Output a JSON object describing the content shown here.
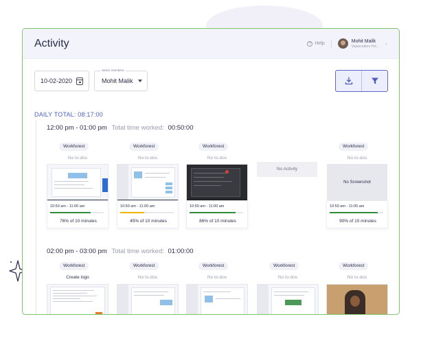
{
  "header": {
    "title": "Activity",
    "help_label": "Help",
    "user_name": "Mohit Malik",
    "user_org": "Valuecoders Pvt..."
  },
  "controls": {
    "date_value": "10-02-2020",
    "member_legend": "Select members",
    "member_value": "Mohit Malik"
  },
  "daily_total": "DAILY TOTAL: 08:17:00",
  "slots": [
    {
      "range": "12:00 pm - 01:00 pm",
      "worked_label": "Total time worked:",
      "worked_value": "00:50:00",
      "cards": [
        {
          "project": "Workforest",
          "todo": "No to-dos",
          "time": "10:50 am - 11:00 am",
          "percent": "76% of 10 minutes",
          "progress": 0.76,
          "bar_color": "#2e8b3a"
        },
        {
          "project": "Workforest",
          "todo": "No to-dos",
          "time": "10:50 am - 11:00 am",
          "percent": "45% of 10 minutes",
          "progress": 0.45,
          "bar_color": "#f0b400"
        },
        {
          "project": "Workforest",
          "todo": "No to-dos",
          "time": "10:50 am - 11:00 am",
          "percent": "86% of 10 minutes",
          "progress": 0.86,
          "bar_color": "#2e8b3a"
        },
        {
          "no_activity": "No Activity"
        },
        {
          "project": "Workforest",
          "todo": "No to-dos",
          "no_screenshot": "No Screenshot",
          "time": "10:50 am - 11:00 am",
          "percent": "90% of 10 minutes",
          "progress": 0.9,
          "bar_color": "#2e8b3a"
        }
      ]
    },
    {
      "range": "02:00 pm - 03:00 pm",
      "worked_label": "Total time worked:",
      "worked_value": "01:00:00",
      "cards": [
        {
          "project": "Workforest",
          "todo": "Create logo"
        },
        {
          "project": "Workforest",
          "todo": "No to-dos"
        },
        {
          "project": "Workforest",
          "todo": "No to-dos"
        },
        {
          "project": "Workforest",
          "todo": "No to-dos"
        },
        {
          "project": "Workforest",
          "todo": "No to-dos"
        }
      ]
    }
  ]
}
